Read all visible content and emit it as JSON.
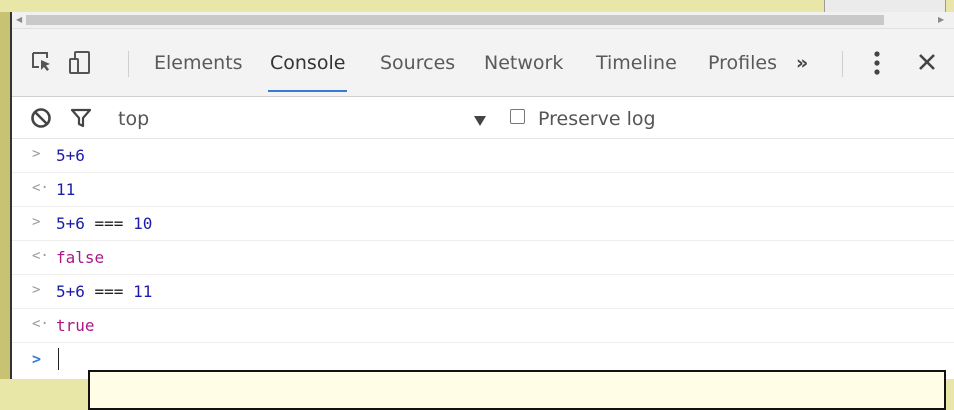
{
  "tabs": [
    "Elements",
    "Console",
    "Sources",
    "Network",
    "Timeline",
    "Profiles"
  ],
  "active_tab": "Console",
  "more_tabs_label": "»",
  "filter": {
    "context": "top",
    "preserve_log_label": "Preserve log"
  },
  "console": {
    "entries": [
      {
        "type": "input",
        "text": "5+6"
      },
      {
        "type": "output",
        "text": "11"
      },
      {
        "type": "input",
        "text": "5+6 === 10"
      },
      {
        "type": "output",
        "text": "false"
      },
      {
        "type": "input",
        "text": "5+6 === 11"
      },
      {
        "type": "output",
        "text": "true"
      }
    ],
    "input_prompt_glyph": ">",
    "output_prompt_glyph": "<·"
  },
  "colors": {
    "accent": "#3879d9",
    "number": "#1c1ca8",
    "keyword": "#aa1a87"
  },
  "icons": [
    "inspect-element-icon",
    "device-toolbar-icon",
    "more-tabs-icon",
    "kebab-menu-icon",
    "close-icon",
    "clear-console-icon",
    "filter-icon",
    "dropdown-arrow-icon"
  ]
}
